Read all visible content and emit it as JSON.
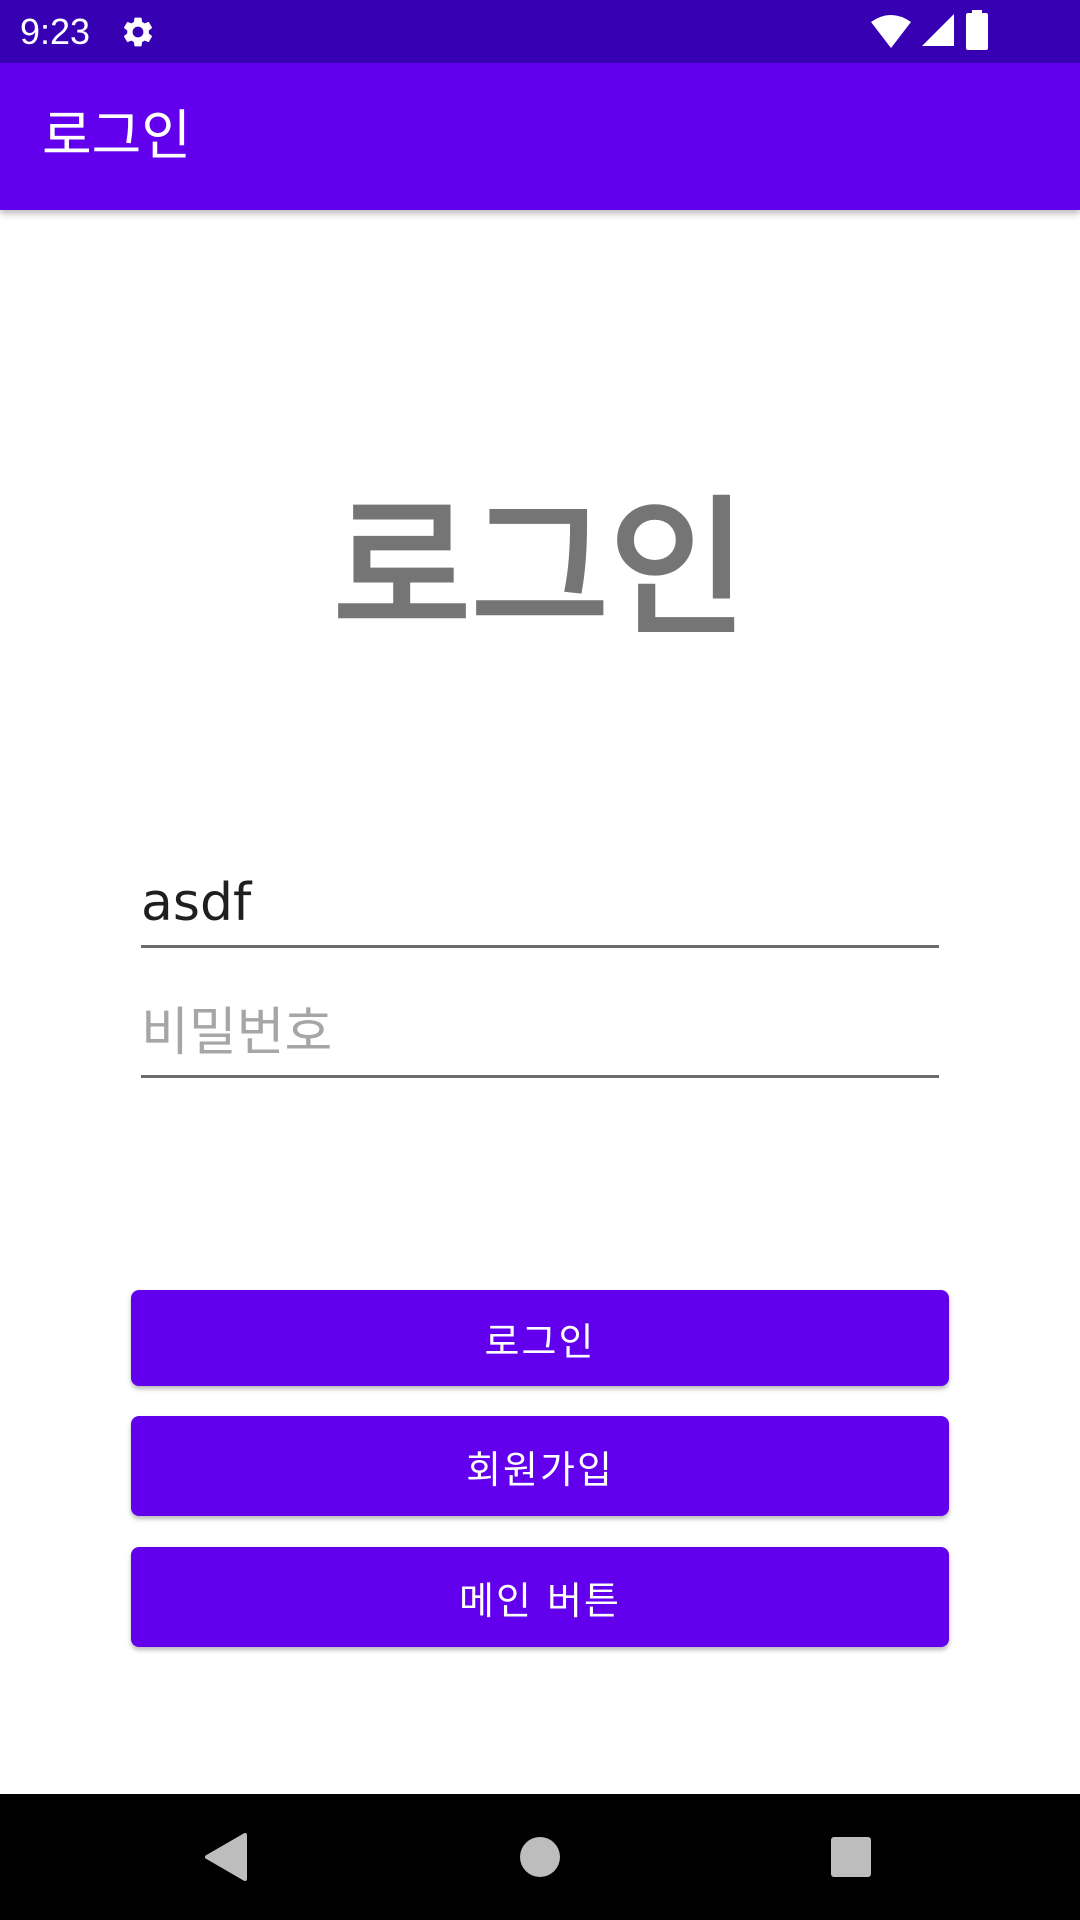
{
  "status_bar": {
    "time": "9:23",
    "icons": [
      "gear-icon",
      "wifi-icon",
      "signal-icon",
      "battery-icon"
    ]
  },
  "app_bar": {
    "title": "로그인"
  },
  "heading": {
    "text": "로그인"
  },
  "form": {
    "username_value": "asdf",
    "password_placeholder": "비밀번호"
  },
  "buttons": {
    "login": "로그인",
    "signup": "회원가입",
    "main": "메인 버튼"
  },
  "nav_bar": {
    "icons": [
      "back-icon",
      "home-icon",
      "recents-icon"
    ]
  },
  "colors": {
    "status_bar": "#3700b3",
    "primary": "#6200ee",
    "heading_text": "#757575",
    "nav_bar": "#000000"
  }
}
